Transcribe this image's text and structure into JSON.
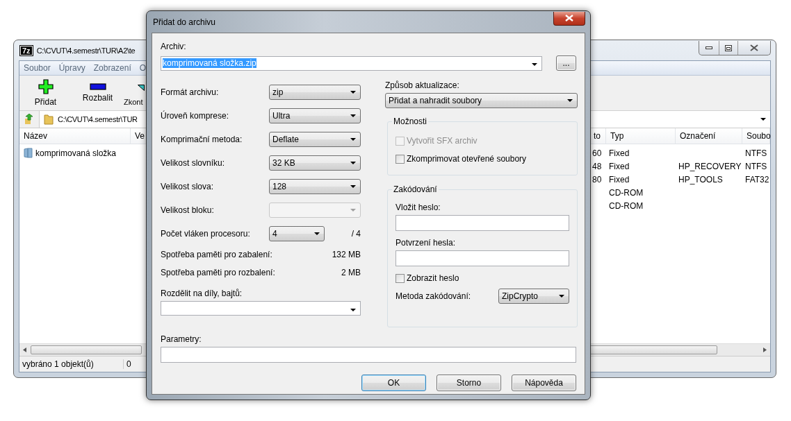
{
  "background_window": {
    "app_logo": "7z",
    "title": "C:\\CVUT\\4.semestr\\TUR\\A2\\te",
    "menu": [
      "Soubor",
      "Úpravy",
      "Zobrazení",
      "O"
    ],
    "toolbar": [
      {
        "label": "Přidat",
        "kind": "add"
      },
      {
        "label": "Rozbalit",
        "kind": "extract"
      },
      {
        "label": "Zkont",
        "kind": "test"
      }
    ],
    "address": "C:\\CVUT\\4.semestr\\TUR",
    "left_columns": [
      "Název",
      "Ve"
    ],
    "left_rows": [
      {
        "name": "komprimovaná složka"
      }
    ],
    "right_columns": [
      "to",
      "Typ",
      "Označení",
      "Soubo"
    ],
    "right_rows": [
      {
        "column_1": "60",
        "type": "Fixed",
        "label": null,
        "file_system": "NTFS"
      },
      {
        "column_1": "48",
        "type": "Fixed",
        "label": "HP_RECOVERY",
        "file_system": "NTFS"
      },
      {
        "column_1": "80",
        "type": "Fixed",
        "label": "HP_TOOLS",
        "file_system": "FAT32"
      },
      {
        "column_1": null,
        "type": "CD-ROM",
        "label": null,
        "file_system": null
      },
      {
        "column_1": null,
        "type": "CD-ROM",
        "label": null,
        "file_system": null
      }
    ],
    "status": [
      "vybráno 1 objekt(ů)",
      "0"
    ]
  },
  "dialog": {
    "title": "Přidat do archivu",
    "archive": {
      "label": "Archiv:",
      "value": "komprimovaná složka.zip",
      "selected": true,
      "browse": "..."
    },
    "settings": [
      {
        "kind": "select",
        "label": "Formát archivu:",
        "value": "zip",
        "disabled": false
      },
      {
        "kind": "select",
        "label": "Úroveň komprese:",
        "value": "Ultra",
        "disabled": false
      },
      {
        "kind": "select",
        "label": "Komprimační metoda:",
        "value": "Deflate",
        "disabled": false
      },
      {
        "kind": "select",
        "label": "Velikost slovníku:",
        "value": "32 KB",
        "disabled": false
      },
      {
        "kind": "select",
        "label": "Velikost slova:",
        "value": "128",
        "disabled": false
      },
      {
        "kind": "select",
        "label": "Velikost bloku:",
        "disabled": true
      },
      {
        "kind": "threads",
        "label": "Počet vláken procesoru:",
        "value": "4",
        "suffix": "/ 4",
        "disabled": false
      },
      {
        "kind": "info",
        "label": "Spotřeba paměti pro zabalení:",
        "value": "132 MB"
      },
      {
        "kind": "info",
        "label": "Spotřeba paměti pro rozbalení:",
        "value": "2 MB"
      }
    ],
    "split": {
      "label": "Rozdělit na díly, bajtů:"
    },
    "update": {
      "label": "Způsob aktualizace:",
      "value": "Přidat a nahradit soubory"
    },
    "options": {
      "title": "Možnosti",
      "items": [
        {
          "label": "Vytvořit SFX archiv",
          "checked": false,
          "disabled": true
        },
        {
          "label": "Zkomprimovat otevřené soubory",
          "checked": false,
          "disabled": false
        }
      ]
    },
    "encryption": {
      "title": "Zakódování",
      "password_label": "Vložit heslo:",
      "confirm_label": "Potvrzení hesla:",
      "show_password": {
        "label": "Zobrazit heslo",
        "checked": false
      },
      "method_label": "Metoda zakódování:",
      "method": "ZipCrypto"
    },
    "parameters": {
      "label": "Parametry:"
    },
    "buttons": [
      {
        "label": "OK",
        "default": true
      },
      {
        "label": "Storno",
        "default": false
      },
      {
        "label": "Nápověda",
        "default": false
      }
    ]
  }
}
